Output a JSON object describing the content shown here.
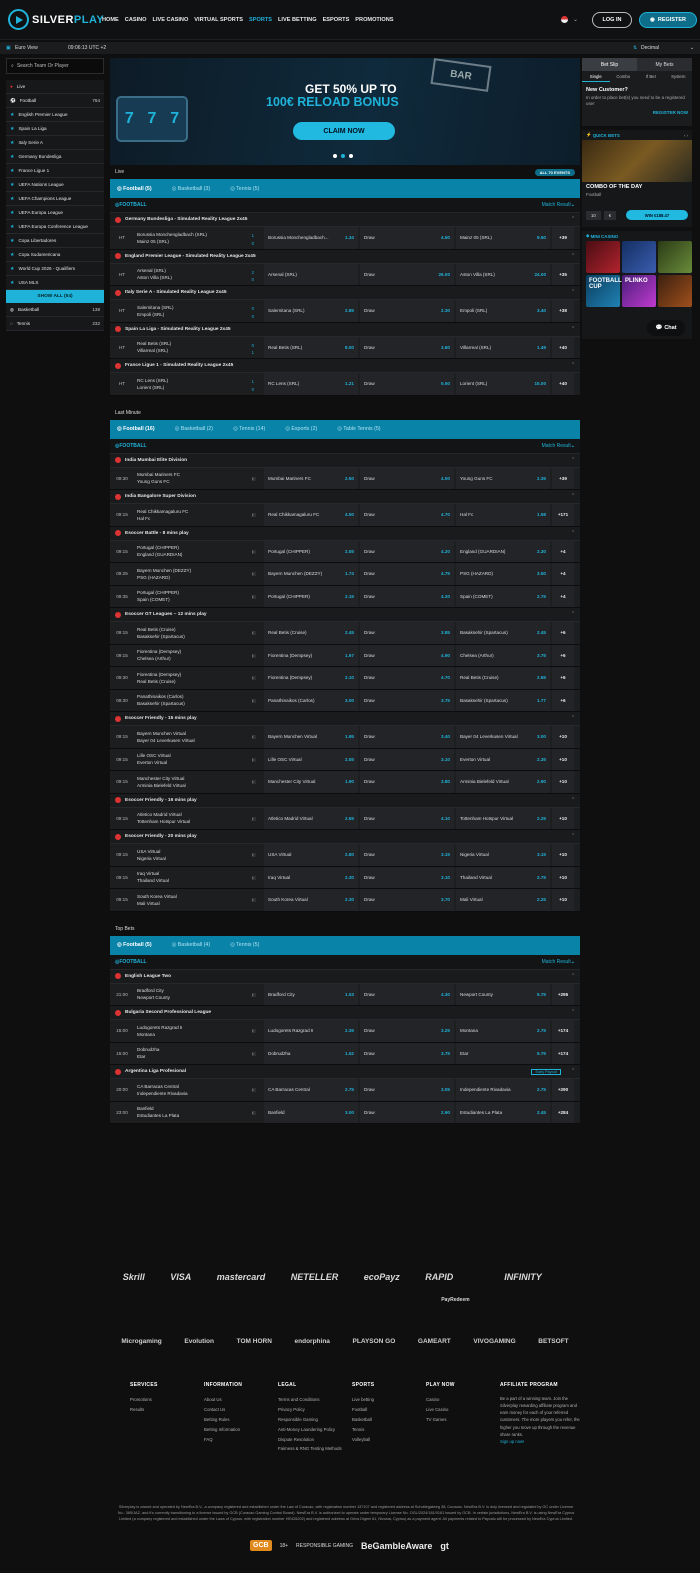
{
  "header": {
    "logo_a": "SILVER",
    "logo_b": "PLAY",
    "nav": [
      "HOME",
      "CASINO",
      "LIVE CASINO",
      "VIRTUAL SPORTS",
      "SPORTS",
      "LIVE BETTING",
      "ESPORTS",
      "PROMOTIONS"
    ],
    "active_nav": "SPORTS",
    "login": "LOG IN",
    "register": "REGISTER"
  },
  "subbar": {
    "view": "Euro View",
    "time": "09:06:13 UTC +2",
    "odds_format": "Decimal"
  },
  "left": {
    "search_placeholder": "Search Team Or Player",
    "live": "Live",
    "football": "Football",
    "football_count": "764",
    "leagues": [
      "English Premier League",
      "Spain La Liga",
      "Italy Serie A",
      "Germany Bundesliga",
      "France Ligue 1",
      "UEFA Nations League",
      "UEFA Champions League",
      "UEFA Europa League",
      "UEFA Europa Conference League",
      "Copa Libertadores",
      "Copa Sudamericana",
      "World Cup 2026 - Qualifiers",
      "USA MLS"
    ],
    "show_all": "SHOW ALL (54)",
    "basketball": "Basketball",
    "basketball_count": "138",
    "tennis": "Tennis",
    "tennis_count": "232"
  },
  "banner": {
    "line1": "GET 50% UP TO",
    "line2": "100€ RELOAD BONUS",
    "cta": "CLAIM NOW",
    "slot": [
      "7",
      "7",
      "7"
    ],
    "sign": "BAR"
  },
  "live": {
    "title": "Live",
    "all_tag": "ALL 70 EVENTS",
    "tabs": [
      "Football (5)",
      "Basketball (3)",
      "Tennis (5)"
    ],
    "sport": "FOOTBALL",
    "market": "Match Result",
    "leagues": [
      {
        "name": "Germany Bundesliga - Simulated Reality League 2x45",
        "events": [
          {
            "time": "HT",
            "home": "Borussia Monchengladbach (SRL)",
            "away": "Mainz 05 (SRL)",
            "s1": "1",
            "s2": "0",
            "h": "Borussia Monchengladbach...",
            "ho": "1.34",
            "d": "Draw",
            "do": "4.50",
            "a": "Mainz 05 (SRL)",
            "ao": "9.50",
            "more": "+39"
          }
        ]
      },
      {
        "name": "England Premier League - Simulated Reality League 2x45",
        "events": [
          {
            "time": "HT",
            "home": "Arsenal (SRL)",
            "away": "Aston Villa (SRL)",
            "s1": "2",
            "s2": "0",
            "h": "Arsenal (SRL)",
            "ho": "",
            "d": "Draw",
            "do": "26.00",
            "a": "Aston Villa (SRL)",
            "ao": "24.00",
            "more": "+35"
          }
        ]
      },
      {
        "name": "Italy Serie A - Simulated Reality League 2x45",
        "events": [
          {
            "time": "HT",
            "home": "Salernitana (SRL)",
            "away": "Empoli (SRL)",
            "s1": "0",
            "s2": "0",
            "h": "Salernitana (SRL)",
            "ho": "2.85",
            "d": "Draw",
            "do": "2.30",
            "a": "Empoli (SRL)",
            "ao": "3.40",
            "more": "+38"
          }
        ]
      },
      {
        "name": "Spain La Liga - Simulated Reality League 2x45",
        "events": [
          {
            "time": "HT",
            "home": "Real Betis (SRL)",
            "away": "Villarreal (SRL)",
            "s1": "0",
            "s2": "1",
            "h": "Real Betis (SRL)",
            "ho": "8.00",
            "d": "Draw",
            "do": "3.60",
            "a": "Villarreal (SRL)",
            "ao": "1.49",
            "more": "+40"
          }
        ]
      },
      {
        "name": "France Ligue 1 - Simulated Reality League 2x45",
        "events": [
          {
            "time": "HT",
            "home": "RC Lens (SRL)",
            "away": "Lorient (SRL)",
            "s1": "1",
            "s2": "0",
            "h": "RC Lens (SRL)",
            "ho": "1.21",
            "d": "Draw",
            "do": "5.50",
            "a": "Lorient (SRL)",
            "ao": "15.00",
            "more": "+40"
          }
        ]
      }
    ]
  },
  "lastminute": {
    "title": "Last Minute",
    "tabs": [
      "Football (16)",
      "Basketball (2)",
      "Tennis (14)",
      "Esports (2)",
      "Table Tennis (5)"
    ],
    "sport": "FOOTBALL",
    "market": "Match Result",
    "leagues": [
      {
        "name": "India Mumbai Elite Division",
        "events": [
          {
            "time": "09:30",
            "home": "Mumbai Mariners FC",
            "away": "Young Guns FC",
            "h": "Mumbai Mariners FC",
            "ho": "2.50",
            "d": "Draw",
            "do": "4.00",
            "a": "Young Guns FC",
            "ao": "2.35",
            "more": "+39"
          }
        ]
      },
      {
        "name": "India Bangalore Super Division",
        "events": [
          {
            "time": "09:15",
            "home": "Real Chikkamagaluru FC",
            "away": "Hal Fc",
            "h": "Real Chikkamagaluru FC",
            "ho": "4.50",
            "d": "Draw",
            "do": "4.70",
            "a": "Hal Fc",
            "ao": "1.58",
            "more": "+171"
          }
        ]
      },
      {
        "name": "Esoccer Battle - 8 mins play",
        "events": [
          {
            "time": "09:15",
            "home": "Portugal (CHIPPER)",
            "away": "England (GUARDIAN)",
            "h": "Portugal (CHIPPER)",
            "ho": "2.55",
            "d": "Draw",
            "do": "4.20",
            "a": "England (GUARDIAN)",
            "ao": "2.30",
            "more": "+4"
          },
          {
            "time": "09:25",
            "home": "Bayern Munchen (DEZZY)",
            "away": "PSG (HAZARD)",
            "h": "Bayern Munchen (DEZZY)",
            "ho": "1.74",
            "d": "Draw",
            "do": "4.75",
            "a": "PSG (HAZARD)",
            "ao": "3.50",
            "more": "+4"
          },
          {
            "time": "09:35",
            "home": "Portugal (CHIPPER)",
            "away": "Spain (COMET)",
            "h": "Portugal (CHIPPER)",
            "ho": "2.15",
            "d": "Draw",
            "do": "4.20",
            "a": "Spain (COMET)",
            "ao": "2.75",
            "more": "+4"
          }
        ]
      },
      {
        "name": "Esoccer GT Leagues – 12 mins play",
        "events": [
          {
            "time": "09:15",
            "home": "Real Betis (Cruise)",
            "away": "Basaksehir (Spartacus)",
            "h": "Real Betis (Cruise)",
            "ho": "2.45",
            "d": "Draw",
            "do": "3.85",
            "a": "Basaksehir (Spartacus)",
            "ao": "2.45",
            "more": "+6"
          },
          {
            "time": "09:15",
            "home": "Fiorentina (Dempsey)",
            "away": "Chelsea (Arthur)",
            "h": "Fiorentina (Dempsey)",
            "ho": "1.67",
            "d": "Draw",
            "do": "4.90",
            "a": "Chelsea (Arthur)",
            "ao": "3.75",
            "more": "+6"
          },
          {
            "time": "09:30",
            "home": "Fiorentina (Dempsey)",
            "away": "Real Betis (Cruise)",
            "h": "Fiorentina (Dempsey)",
            "ho": "2.10",
            "d": "Draw",
            "do": "4.70",
            "a": "Real Betis (Cruise)",
            "ao": "2.65",
            "more": "+6"
          },
          {
            "time": "09:30",
            "home": "Panathinaikos (Carlos)",
            "away": "Basaksehir (Spartacus)",
            "h": "Panathinaikos (Carlos)",
            "ho": "3.00",
            "d": "Draw",
            "do": "3.75",
            "a": "Basaksehir (Spartacus)",
            "ao": "1.77",
            "more": "+6"
          }
        ]
      },
      {
        "name": "Esoccer Friendly - 15 mins play",
        "events": [
          {
            "time": "09:15",
            "home": "Bayern Munchen Virtual",
            "away": "Bayer 04 Leverkusen Virtual",
            "h": "Bayern Munchen Virtual",
            "ho": "1.95",
            "d": "Draw",
            "do": "3.40",
            "a": "Bayer 04 Leverkusen Virtual",
            "ao": "3.00",
            "more": "+10"
          },
          {
            "time": "09:15",
            "home": "Lille OSC Virtual",
            "away": "Everton Virtual",
            "h": "Lille OSC Virtual",
            "ho": "2.55",
            "d": "Draw",
            "do": "3.10",
            "a": "Everton Virtual",
            "ao": "2.35",
            "more": "+10"
          },
          {
            "time": "09:15",
            "home": "Manchester City Virtual",
            "away": "Arminia Bielefeld Virtual",
            "h": "Manchester City Virtual",
            "ho": "1.90",
            "d": "Draw",
            "do": "3.80",
            "a": "Arminia Bielefeld Virtual",
            "ao": "2.90",
            "more": "+10"
          }
        ]
      },
      {
        "name": "Esoccer Friendly - 16 mins play",
        "events": [
          {
            "time": "09:15",
            "home": "Atletico Madrid Virtual",
            "away": "Tottenham Hotspur Virtual",
            "h": "Atletico Madrid Virtual",
            "ho": "2.65",
            "d": "Draw",
            "do": "4.10",
            "a": "Tottenham Hotspur Virtual",
            "ao": "2.25",
            "more": "+10"
          }
        ]
      },
      {
        "name": "Esoccer Friendly - 20 mins play",
        "events": [
          {
            "time": "09:15",
            "home": "USA Virtual",
            "away": "Nigeria Virtual",
            "h": "USA Virtual",
            "ho": "2.80",
            "d": "Draw",
            "do": "3.15",
            "a": "Nigeria Virtual",
            "ao": "3.15",
            "more": "+10"
          },
          {
            "time": "09:15",
            "home": "Iraq Virtual",
            "away": "Thailand Virtual",
            "h": "Iraq Virtual",
            "ho": "2.30",
            "d": "Draw",
            "do": "3.10",
            "a": "Thailand Virtual",
            "ao": "2.75",
            "more": "+10"
          },
          {
            "time": "09:15",
            "home": "South Korea Virtual",
            "away": "Mali Virtual",
            "h": "South Korea Virtual",
            "ho": "2.30",
            "d": "Draw",
            "do": "3.70",
            "a": "Mali Virtual",
            "ao": "2.25",
            "more": "+10"
          }
        ]
      }
    ]
  },
  "topbets": {
    "title": "Top Bets",
    "tabs": [
      "Football (5)",
      "Basketball (4)",
      "Tennis (5)"
    ],
    "sport": "FOOTBALL",
    "market": "Match Result",
    "leagues": [
      {
        "name": "English League Two",
        "events": [
          {
            "time": "21:00",
            "home": "Bradford City",
            "away": "Newport County",
            "h": "Bradford City",
            "ho": "1.53",
            "d": "Draw",
            "do": "4.30",
            "a": "Newport County",
            "ao": "5.75",
            "more": "+295"
          }
        ]
      },
      {
        "name": "Bulgaria Second Professional League",
        "events": [
          {
            "time": "15:00",
            "home": "Ludogorets Razgrad II",
            "away": "Montana",
            "h": "Ludogorets Razgrad II",
            "ho": "2.35",
            "d": "Draw",
            "do": "3.25",
            "a": "Montana",
            "ao": "2.75",
            "more": "+174"
          },
          {
            "time": "15:00",
            "home": "Dobrudzha",
            "away": "Etar",
            "h": "Dobrudzha",
            "ho": "1.52",
            "d": "Draw",
            "do": "3.75",
            "a": "Etar",
            "ao": "5.75",
            "more": "+174"
          }
        ]
      },
      {
        "name": "Argentina Liga Profesional",
        "tag": "Early Payout",
        "events": [
          {
            "time": "20:00",
            "home": "CA Barracas Central",
            "away": "Independiente Rivadavia",
            "h": "CA Barracas Central",
            "ho": "2.75",
            "d": "Draw",
            "do": "3.05",
            "a": "Independiente Rivadavia",
            "ao": "2.75",
            "more": "+290"
          },
          {
            "time": "23:00",
            "home": "Banfield",
            "away": "Estudiantes La Plata",
            "h": "Banfield",
            "ho": "3.00",
            "d": "Draw",
            "do": "2.90",
            "a": "Estudiantes La Plata",
            "ao": "2.45",
            "more": "+284"
          }
        ]
      }
    ]
  },
  "betslip": {
    "tab1": "Bet Slip",
    "tab2": "My Bets",
    "sub": [
      "Single",
      "Combo",
      "If Bet",
      "System"
    ],
    "title": "New Customer?",
    "text": "In order to place bet(s) you need to be a registered user",
    "register": "REGISTER NOW"
  },
  "quickbets": {
    "title": "QUICK BETS",
    "name": "COMBO OF THE DAY",
    "sport": "Football",
    "stake": "10",
    "currency": "€",
    "win": "WIN €188.47"
  },
  "minicasino": {
    "title": "MINI CASINO",
    "tile1": "FOOTBALL CUP",
    "tile2": "PLINKO"
  },
  "chat": "Chat",
  "payments": [
    "Skrill",
    "VISA",
    "mastercard",
    "NETELLER",
    "ecoPayz",
    "RAPID",
    "",
    "INFINITY",
    "",
    "",
    "PayRedeem"
  ],
  "providers": [
    "Microgaming",
    "Evolution",
    "TOM HORN",
    "endorphina",
    "PLAYSON GO",
    "GAMEART",
    "VIVOGAMING",
    "BETSOFT"
  ],
  "footer": {
    "cols": [
      {
        "title": "SERVICES",
        "items": [
          "Promotions",
          "Results"
        ]
      },
      {
        "title": "INFORMATION",
        "items": [
          "About Us",
          "Contact Us",
          "Betting Rules",
          "Betting Information",
          "FAQ"
        ]
      },
      {
        "title": "LEGAL",
        "items": [
          "Terms and Conditions",
          "Privacy Policy",
          "Responsible Gaming",
          "Anti-Money Laundering Policy",
          "Dispute Resolution",
          "Fairness & RNG Testing Methods"
        ]
      },
      {
        "title": "SPORTS",
        "items": [
          "Live betting",
          "Football",
          "Basketball",
          "Tennis",
          "Volleyball"
        ]
      },
      {
        "title": "PLAY NOW",
        "items": [
          "Casino",
          "Live Casino",
          "TV Games"
        ]
      }
    ],
    "affiliate_title": "AFFILIATE PROGRAM",
    "affiliate_text": "Be a part of a winning team. Join the Silverplay rewarding affiliate program and earn money for each of your referred customers. The more players you refer, the higher you move up through the revenue share ranks.",
    "affiliate_link": "Sign up now!",
    "legal": "Silverplay is owned and operated by NewEra B.V., a company registered and established under the Law of Curacao, with registration number 137107 and registered address at Schottegatweg 38, Curacao. NewEra B.V. is duly licensed and regulated by GC under License No.: 365/JAZ, and it's currently transitioning to a license issued by GCB (Curacao Gaming Control Board). NewEra B.V. is authorized to operate under temporary License No. OGL/2024/181/0181 issued by GCB. In certain jurisdictions, NewEra B.V. is using NewEra Cyprus Limited (a company registered and established under the Laws of Cyprus, with registration number HE426202) and registered address at Griva Digeni 61, Nicosia, Cyprus) as a payment agent. All payments related to Payvalo will be processed by NewEra Cyprus Limited.",
    "bottom": [
      "GCB",
      "18+",
      "RESPONSIBLE GAMING",
      "BeGambleAware",
      "gt"
    ]
  }
}
